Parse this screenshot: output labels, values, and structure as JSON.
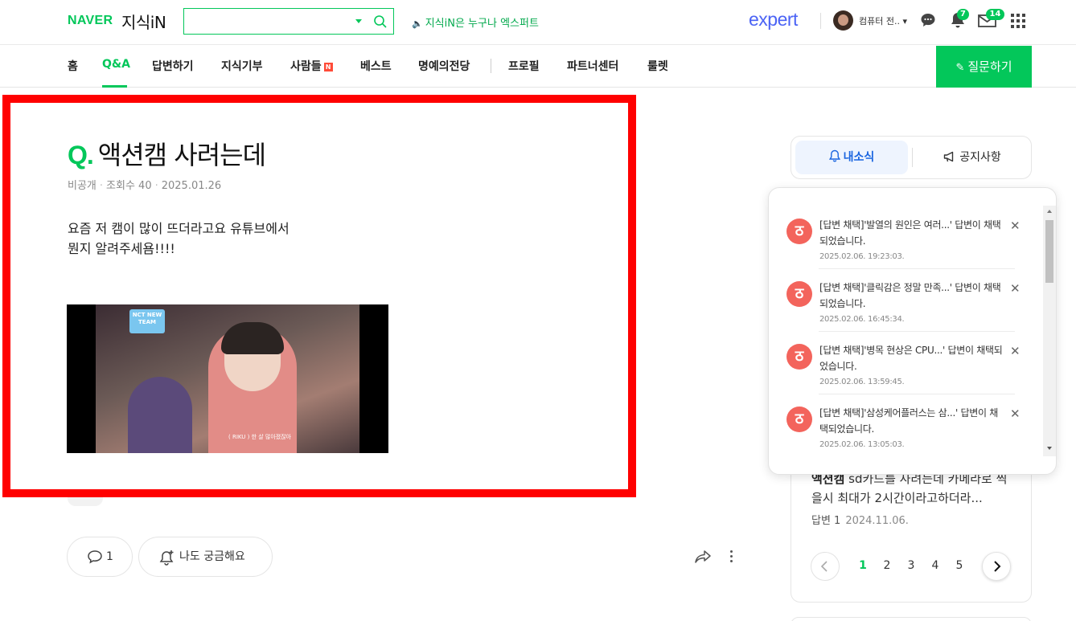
{
  "header": {
    "logo_naver": "NAVER",
    "logo_service": "지식iN",
    "search_placeholder": "",
    "notice": "지식iN은 누구나 엑스퍼트",
    "expert_logo": "expert",
    "user_name": "컴퓨터 전..",
    "bell_count": "7",
    "mail_count": "14",
    "accent_color": "#03c75a"
  },
  "nav": {
    "items": [
      "홈",
      "Q&A",
      "답변하기",
      "지식기부",
      "사람들",
      "베스트",
      "명예의전당",
      "프로필",
      "파트너센터",
      "룰렛"
    ],
    "active": "Q&A",
    "new_badge": "N",
    "ask_button": "질문하기"
  },
  "question": {
    "q_mark": "Q.",
    "title": "액션캠 사려는데",
    "author": "비공개",
    "views": "조회수 40",
    "date": "2025.01.26",
    "body_line1": "요즘 저 캠이 많이 뜨더라고요 유튜브에서",
    "body_line2": "뭔지 알려주세욤!!!!",
    "video_tag": "NCT NEW TEAM",
    "video_subtitle": "( RIKU ) 한 살 많아졌잖아",
    "comment_count": "1",
    "curious_label": "나도 궁금해요"
  },
  "sidebar": {
    "tab_my_news": "내소식",
    "tab_notice": "공지사항",
    "related_keyword": "액션캠",
    "related_title_rest": " sd카드를 사려는데 카메라로 찍을시 최대가 2시간이라고하더라...",
    "related_answers": "답변 1",
    "related_date": "2024.11.06.",
    "pages": [
      "1",
      "2",
      "3",
      "4",
      "5"
    ],
    "active_page": "1"
  },
  "notifications": [
    {
      "text": "[답변 채택]'발열의 원인은 여러...' 답변이 채택되었습니다.",
      "date": "2025.02.06. 19:23:03."
    },
    {
      "text": "[답변 채택]'클릭감은 정말 만족...' 답변이 채택되었습니다.",
      "date": "2025.02.06. 16:45:34."
    },
    {
      "text": "[답변 채택]'병목 현상은 CPU...' 답변이 채택되었습니다.",
      "date": "2025.02.06. 13:59:45."
    },
    {
      "text": "[답변 채택]'삼성케어플러스는 삼...' 답변이 채택되었습니다.",
      "date": "2025.02.06. 13:05:03."
    }
  ]
}
